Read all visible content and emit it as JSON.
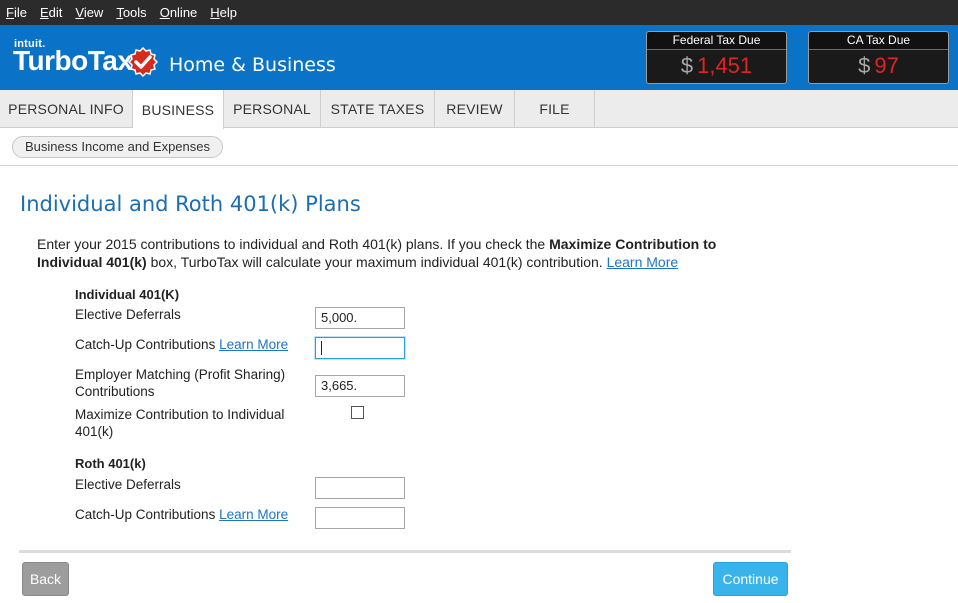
{
  "menubar": {
    "items": [
      {
        "label": "File",
        "accel": "F",
        "rest": "ile"
      },
      {
        "label": "Edit",
        "accel": "E",
        "rest": "dit"
      },
      {
        "label": "View",
        "accel": "V",
        "rest": "iew"
      },
      {
        "label": "Tools",
        "accel": "T",
        "rest": "ools"
      },
      {
        "label": "Online",
        "accel": "O",
        "rest": "nline"
      },
      {
        "label": "Help",
        "accel": "H",
        "rest": "elp"
      }
    ]
  },
  "header": {
    "intuit": "intuit.",
    "brand": "TurboTax",
    "product": "Home & Business",
    "check_icon": "checkmark-badge-icon",
    "federal": {
      "title": "Federal Tax Due",
      "currency": "$",
      "amount": "1,451"
    },
    "state": {
      "title": "CA Tax Due",
      "currency": "$",
      "amount": "97"
    },
    "colors": {
      "header_bg": "#0a72c7",
      "amount": "#e02424"
    }
  },
  "tabs": [
    {
      "label": "PERSONAL INFO",
      "active": false
    },
    {
      "label": "BUSINESS",
      "active": true
    },
    {
      "label": "PERSONAL",
      "active": false
    },
    {
      "label": "STATE TAXES",
      "active": false
    },
    {
      "label": "REVIEW",
      "active": false
    },
    {
      "label": "FILE",
      "active": false
    }
  ],
  "breadcrumb": {
    "label": "Business Income and Expenses"
  },
  "page": {
    "title": "Individual and Roth 401(k) Plans",
    "intro_part1": "Enter your 2015 contributions to individual and Roth 401(k) plans. If you check the ",
    "intro_bold": "Maximize Contribution to Individual 401(k)",
    "intro_part2": " box, TurboTax will calculate your maximum individual 401(k) contribution. ",
    "intro_link": "Learn More"
  },
  "individual": {
    "heading": "Individual 401(K)",
    "elective_label": "Elective Deferrals",
    "elective_value": "5,000.",
    "catchup_label": "Catch-Up Contributions",
    "catchup_link": "Learn More",
    "catchup_value": "",
    "employer_label": "Employer Matching (Profit Sharing) Contributions",
    "employer_value": "3,665.",
    "maximize_label": "Maximize Contribution to Individual 401(k)",
    "maximize_checked": false
  },
  "roth": {
    "heading": "Roth 401(k)",
    "elective_label": "Elective Deferrals",
    "elective_value": "",
    "catchup_label": "Catch-Up Contributions",
    "catchup_link": "Learn More",
    "catchup_value": ""
  },
  "buttons": {
    "back": "Back",
    "continue": "Continue"
  }
}
